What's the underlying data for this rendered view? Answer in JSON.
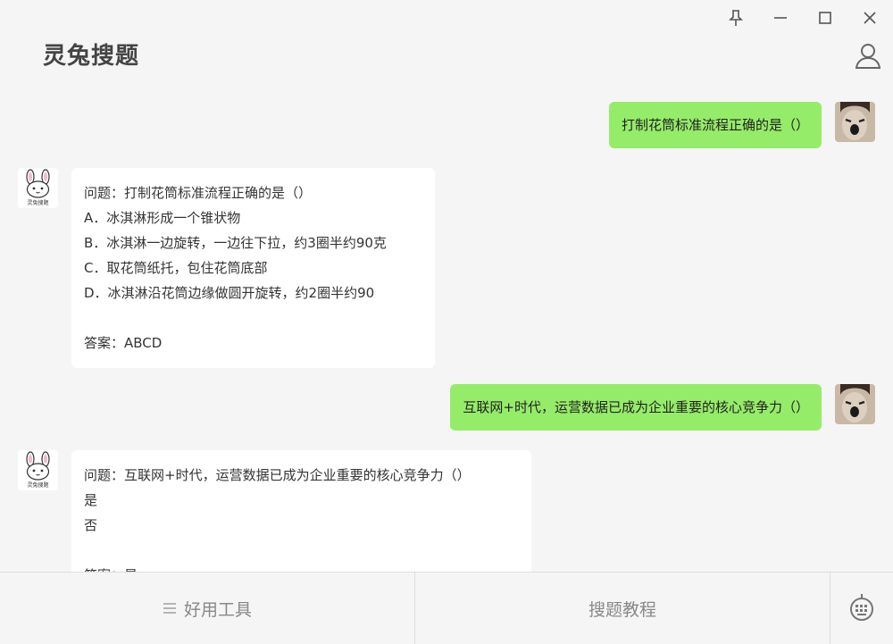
{
  "app": {
    "title": "灵兔搜题"
  },
  "window_controls": {
    "pin": "pin",
    "minimize": "minimize",
    "maximize": "maximize",
    "close": "close"
  },
  "messages": [
    {
      "from": "user",
      "text": "打制花筒标准流程正确的是（）"
    },
    {
      "from": "bot",
      "lines": [
        "问题：打制花筒标准流程正确的是（）",
        "A．冰淇淋形成一个锥状物",
        "B．冰淇淋一边旋转，一边往下拉，约3圈半约90克",
        "C．取花筒纸托，包住花筒底部",
        "D．冰淇淋沿花筒边缘做圆开旋转，约2圈半约90",
        "",
        "答案：ABCD"
      ]
    },
    {
      "from": "user",
      "text": "互联网+时代，运营数据已成为企业重要的核心竞争力（）"
    },
    {
      "from": "bot",
      "lines": [
        "问题：互联网+时代，运营数据已成为企业重要的核心竞争力（）",
        "是",
        "否",
        "",
        "答案：是"
      ]
    }
  ],
  "bot_avatar_text": "灵兔搜题",
  "footer": {
    "tools_label": "好用工具",
    "tutorial_label": "搜题教程"
  },
  "colors": {
    "user_bubble": "#95ec69",
    "bot_bubble": "#ffffff",
    "background": "#f5f5f5"
  }
}
